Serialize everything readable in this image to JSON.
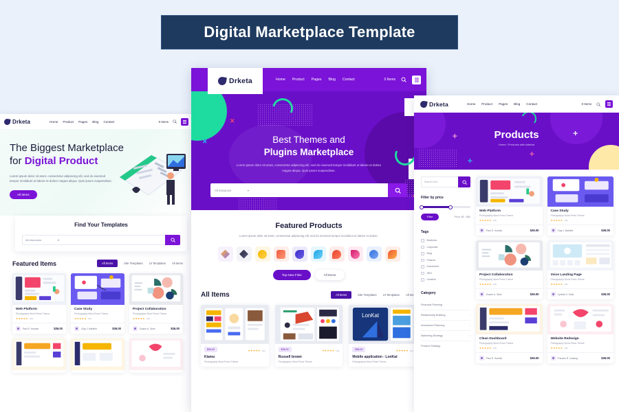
{
  "banner": {
    "title": "Digital Marketplace Template"
  },
  "brand": {
    "name": "Drketa",
    "accent": "#7b13d8",
    "dark": "#1b1b3a",
    "hero_purple": "#6a0fc8",
    "mint": "#1edba0"
  },
  "nav": {
    "items": [
      "Home",
      "Product",
      "Pages",
      "Blog",
      "Contact"
    ],
    "cart": "0 Items",
    "search_icon": "search-icon",
    "menu_icon": "hamburger-icon"
  },
  "left_panel": {
    "hero": {
      "title_line1": "The Biggest Marketplace",
      "title_line2_plain": "for ",
      "title_line2_accent": "Digital Product",
      "paragraph": "Lorem ipsum dolor sit amet, consectetur adipiscing elit, sed do eiusmod tempor incididunt ut labore et dolore magna aliqua. Quis ipsum suspendisse.",
      "cta": "All Items"
    },
    "find": {
      "heading": "Find Your Templates",
      "select_value": "All resources",
      "input_placeholder": "",
      "search_icon": "search-icon"
    },
    "featured": {
      "heading": "Featured Items",
      "tabs": [
        "All Items",
        "Site Templates",
        "UI Templates",
        "All Items"
      ],
      "active_tab": "All Items"
    },
    "cards": [
      {
        "name": "Web Platform",
        "sub": "Photography Word Press Theme",
        "rating": "(15)",
        "author": "Paul E. Horwitz",
        "price": "$36.00"
      },
      {
        "name": "Case Study",
        "sub": "Photography Word Press Theme",
        "rating": "(15)",
        "author": "Clay J. Barfield",
        "price": "$36.00"
      },
      {
        "name": "Project Collaboration",
        "sub": "Photography Word Press Theme",
        "rating": "(15)",
        "author": "Duane A. Olive",
        "price": "$36.00"
      }
    ]
  },
  "center_panel": {
    "hero": {
      "title_line1": "Best Themes and",
      "title_line2": "Plugins Marketplace",
      "paragraph": "Lorem ipsum dolor sit amet, consectetur adipiscing elit, sed do eiusmod tempor incididunt ut labore et dolore magna aliqua. Quis ipsum suspendisse.",
      "select_value": "All resources",
      "search_icon": "search-icon"
    },
    "featured": {
      "heading": "Featured Products",
      "paragraph": "Lorem ipsum dolor sit amet, consectetur adipiscing elit, sed do eiusmod tempor incididunt ut labore et dolore.",
      "icons": [
        {
          "name": "brush-icon",
          "c1": "#f8b43a",
          "c2": "#8e6bf0",
          "bg": "#f6f1fc"
        },
        {
          "name": "diamond-icon",
          "c1": "#2b2b45",
          "c2": "#5a5a7a",
          "bg": "#f4f4f8"
        },
        {
          "name": "circle-icon",
          "c1": "#f5b500",
          "c2": "#ffd34d",
          "bg": "#fdf6e3"
        },
        {
          "name": "chat-icon",
          "c1": "#f05a3c",
          "c2": "#ff9a7a",
          "bg": "#fdeeea"
        },
        {
          "name": "leaf-icon",
          "c1": "#3b2fc9",
          "c2": "#6c5ce7",
          "bg": "#eceafa"
        },
        {
          "name": "wave-icon",
          "c1": "#1ea7e8",
          "c2": "#6fd0f5",
          "bg": "#e8f6fd"
        },
        {
          "name": "drop-icon",
          "c1": "#e8412d",
          "c2": "#ff7a5c",
          "bg": "#fdecea"
        },
        {
          "name": "flame-icon",
          "c1": "#d11a6c",
          "c2": "#ff7ab0",
          "bg": "#fdeaf2"
        },
        {
          "name": "globe-icon",
          "c1": "#2f6fe0",
          "c2": "#7fa9f2",
          "bg": "#eaf1fd"
        },
        {
          "name": "ribbon-icon",
          "c1": "#f0542d",
          "c2": "#fdb44c",
          "bg": "#fdeee7"
        }
      ],
      "btn_primary": "Top New Files",
      "btn_secondary": "All Items"
    },
    "all_items": {
      "heading": "All Items",
      "tabs": [
        "All Items",
        "Site Templates",
        "UI Templates",
        "All Items"
      ],
      "active_tab": "All Items",
      "cards": [
        {
          "name": "Kiamu",
          "sub": "Photography Word Press Theme",
          "price": "$36.00",
          "rating": "(15)"
        },
        {
          "name": "Russell brown",
          "sub": "Photography Word Press Theme",
          "price": "$36.00",
          "rating": "(15)"
        },
        {
          "name": "Mobile application - LonKat",
          "sub": "Photography Word Press Theme",
          "price": "$36.00",
          "rating": "(15)"
        }
      ]
    }
  },
  "right_panel": {
    "hero": {
      "title": "Products",
      "breadcrumb": "Home / Products with sidebar"
    },
    "sidebar": {
      "search_placeholder": "Search here",
      "search_icon": "search-icon",
      "price_heading": "Filter by price",
      "filter_button": "Filter",
      "price_range": "Price: $0 - $80",
      "tags_heading": "Tags",
      "tags": [
        "Business",
        "Corporate",
        "Blog",
        "Finance",
        "Investment",
        "SEO",
        "Creative"
      ],
      "category_heading": "Category",
      "categories": [
        "Financial Planning",
        "Relationship Building",
        "Investment Planning",
        "Marketing Strategy",
        "Product Strategy"
      ]
    },
    "cards": [
      {
        "name": "Web Platform",
        "sub": "Photography Word Press Theme",
        "rating": "(15)",
        "author": "Paul E. Horwitz",
        "price": "$36.00"
      },
      {
        "name": "Case Study",
        "sub": "Photography Word Press Theme",
        "rating": "(15)",
        "author": "Clay J. Barfield",
        "price": "$36.00"
      },
      {
        "name": "Project Collaboration",
        "sub": "Photography Word Press Theme",
        "rating": "(15)",
        "author": "Duane A. Olive",
        "price": "$36.00"
      },
      {
        "name": "Voice Landing Page",
        "sub": "Photography Word Press Theme",
        "rating": "(15)",
        "author": "Cynthia V. Solis",
        "price": "$36.00"
      },
      {
        "name": "Clean Dashboard",
        "sub": "Photography Word Press Theme",
        "rating": "(15)",
        "author": "Paul E. Horwitz",
        "price": "$36.00"
      },
      {
        "name": "Website Redesign",
        "sub": "Photography Word Press Theme",
        "rating": "(15)",
        "author": "Frances R. Lansing",
        "price": "$36.00"
      }
    ]
  }
}
